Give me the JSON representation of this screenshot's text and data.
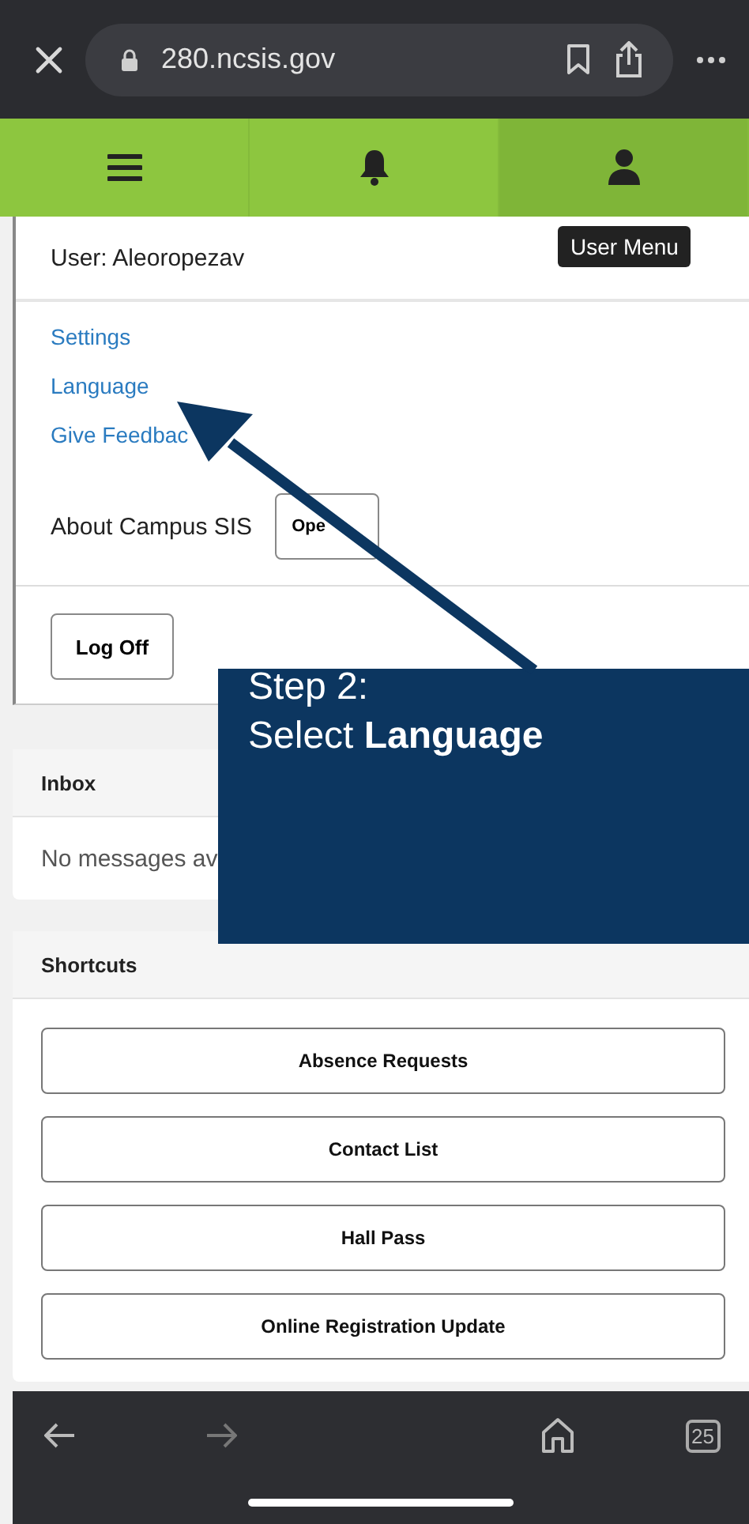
{
  "browser": {
    "url": "280.ncsis.gov",
    "tab_count": "25"
  },
  "nav": [
    {
      "kind": "menu",
      "selected": false
    },
    {
      "kind": "bell",
      "selected": false
    },
    {
      "kind": "user",
      "selected": true
    }
  ],
  "tooltip": "User Menu",
  "user_menu": {
    "user": "User: Aleoropezav",
    "links": [
      "Settings",
      "Language",
      "Give Feedbac"
    ],
    "about": {
      "label": "About Campus SIS",
      "button": "Ope"
    },
    "log_off": "Log Off"
  },
  "inbox": {
    "title": "Inbox",
    "message": "No messages av"
  },
  "shortcuts": {
    "title": "Shortcuts",
    "buttons": [
      "Absence Requests",
      "Contact List",
      "Hall Pass",
      "Online Registration Update"
    ]
  },
  "callout": {
    "lines": [
      "Step 2:",
      "Select **Language**"
    ]
  }
}
